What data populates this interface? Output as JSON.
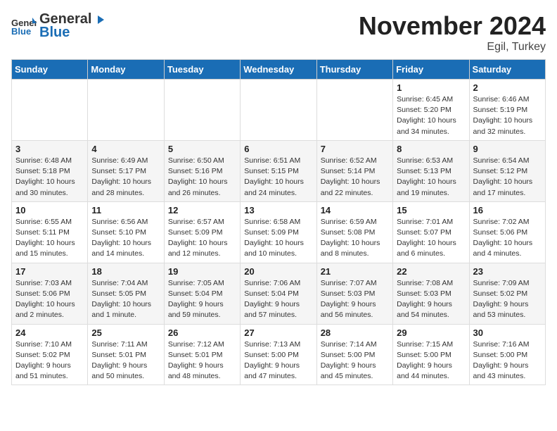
{
  "logo": {
    "general": "General",
    "blue": "Blue"
  },
  "header": {
    "month": "November 2024",
    "location": "Egil, Turkey"
  },
  "weekdays": [
    "Sunday",
    "Monday",
    "Tuesday",
    "Wednesday",
    "Thursday",
    "Friday",
    "Saturday"
  ],
  "weeks": [
    [
      {
        "day": "",
        "info": ""
      },
      {
        "day": "",
        "info": ""
      },
      {
        "day": "",
        "info": ""
      },
      {
        "day": "",
        "info": ""
      },
      {
        "day": "",
        "info": ""
      },
      {
        "day": "1",
        "info": "Sunrise: 6:45 AM\nSunset: 5:20 PM\nDaylight: 10 hours and 34 minutes."
      },
      {
        "day": "2",
        "info": "Sunrise: 6:46 AM\nSunset: 5:19 PM\nDaylight: 10 hours and 32 minutes."
      }
    ],
    [
      {
        "day": "3",
        "info": "Sunrise: 6:48 AM\nSunset: 5:18 PM\nDaylight: 10 hours and 30 minutes."
      },
      {
        "day": "4",
        "info": "Sunrise: 6:49 AM\nSunset: 5:17 PM\nDaylight: 10 hours and 28 minutes."
      },
      {
        "day": "5",
        "info": "Sunrise: 6:50 AM\nSunset: 5:16 PM\nDaylight: 10 hours and 26 minutes."
      },
      {
        "day": "6",
        "info": "Sunrise: 6:51 AM\nSunset: 5:15 PM\nDaylight: 10 hours and 24 minutes."
      },
      {
        "day": "7",
        "info": "Sunrise: 6:52 AM\nSunset: 5:14 PM\nDaylight: 10 hours and 22 minutes."
      },
      {
        "day": "8",
        "info": "Sunrise: 6:53 AM\nSunset: 5:13 PM\nDaylight: 10 hours and 19 minutes."
      },
      {
        "day": "9",
        "info": "Sunrise: 6:54 AM\nSunset: 5:12 PM\nDaylight: 10 hours and 17 minutes."
      }
    ],
    [
      {
        "day": "10",
        "info": "Sunrise: 6:55 AM\nSunset: 5:11 PM\nDaylight: 10 hours and 15 minutes."
      },
      {
        "day": "11",
        "info": "Sunrise: 6:56 AM\nSunset: 5:10 PM\nDaylight: 10 hours and 14 minutes."
      },
      {
        "day": "12",
        "info": "Sunrise: 6:57 AM\nSunset: 5:09 PM\nDaylight: 10 hours and 12 minutes."
      },
      {
        "day": "13",
        "info": "Sunrise: 6:58 AM\nSunset: 5:09 PM\nDaylight: 10 hours and 10 minutes."
      },
      {
        "day": "14",
        "info": "Sunrise: 6:59 AM\nSunset: 5:08 PM\nDaylight: 10 hours and 8 minutes."
      },
      {
        "day": "15",
        "info": "Sunrise: 7:01 AM\nSunset: 5:07 PM\nDaylight: 10 hours and 6 minutes."
      },
      {
        "day": "16",
        "info": "Sunrise: 7:02 AM\nSunset: 5:06 PM\nDaylight: 10 hours and 4 minutes."
      }
    ],
    [
      {
        "day": "17",
        "info": "Sunrise: 7:03 AM\nSunset: 5:06 PM\nDaylight: 10 hours and 2 minutes."
      },
      {
        "day": "18",
        "info": "Sunrise: 7:04 AM\nSunset: 5:05 PM\nDaylight: 10 hours and 1 minute."
      },
      {
        "day": "19",
        "info": "Sunrise: 7:05 AM\nSunset: 5:04 PM\nDaylight: 9 hours and 59 minutes."
      },
      {
        "day": "20",
        "info": "Sunrise: 7:06 AM\nSunset: 5:04 PM\nDaylight: 9 hours and 57 minutes."
      },
      {
        "day": "21",
        "info": "Sunrise: 7:07 AM\nSunset: 5:03 PM\nDaylight: 9 hours and 56 minutes."
      },
      {
        "day": "22",
        "info": "Sunrise: 7:08 AM\nSunset: 5:03 PM\nDaylight: 9 hours and 54 minutes."
      },
      {
        "day": "23",
        "info": "Sunrise: 7:09 AM\nSunset: 5:02 PM\nDaylight: 9 hours and 53 minutes."
      }
    ],
    [
      {
        "day": "24",
        "info": "Sunrise: 7:10 AM\nSunset: 5:02 PM\nDaylight: 9 hours and 51 minutes."
      },
      {
        "day": "25",
        "info": "Sunrise: 7:11 AM\nSunset: 5:01 PM\nDaylight: 9 hours and 50 minutes."
      },
      {
        "day": "26",
        "info": "Sunrise: 7:12 AM\nSunset: 5:01 PM\nDaylight: 9 hours and 48 minutes."
      },
      {
        "day": "27",
        "info": "Sunrise: 7:13 AM\nSunset: 5:00 PM\nDaylight: 9 hours and 47 minutes."
      },
      {
        "day": "28",
        "info": "Sunrise: 7:14 AM\nSunset: 5:00 PM\nDaylight: 9 hours and 45 minutes."
      },
      {
        "day": "29",
        "info": "Sunrise: 7:15 AM\nSunset: 5:00 PM\nDaylight: 9 hours and 44 minutes."
      },
      {
        "day": "30",
        "info": "Sunrise: 7:16 AM\nSunset: 5:00 PM\nDaylight: 9 hours and 43 minutes."
      }
    ]
  ]
}
